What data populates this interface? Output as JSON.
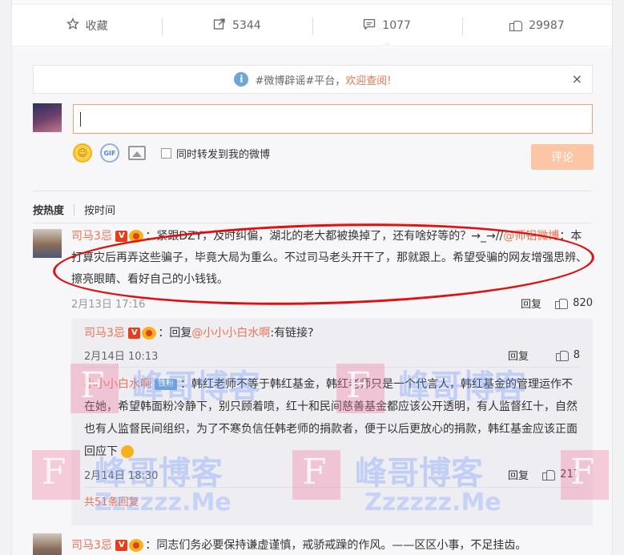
{
  "actions": [
    {
      "icon": "star-icon",
      "label": "收藏"
    },
    {
      "icon": "share-icon",
      "label": "5344"
    },
    {
      "icon": "comment-icon",
      "label": "1077"
    },
    {
      "icon": "thumbs-up-icon",
      "label": "29987"
    }
  ],
  "notice": {
    "text": "#微博辟谣#平台，",
    "link": "欢迎查阅!",
    "close": "×"
  },
  "composer": {
    "forward_label": "同时转发到我的微博",
    "submit": "评论",
    "gif_label": "GIF"
  },
  "sort": {
    "hot": "按热度",
    "time": "按时间"
  },
  "comment1": {
    "user": "司马3忌",
    "text_a": "：紧跟DZY，及时纠偏，湖北的老大都被换掉了，还有啥好等的？→_→//",
    "mention": "@师铝微博",
    "text_b": "：本打算灾后再弄这些骗子，毕竟大局为重么。不过司马老头开干了，那就跟上。希望受骗的网友增强思辨、擦亮眼睛、看好自己的小钱钱。",
    "time": "2月13日 17:16",
    "reply": "回复",
    "likes": "820"
  },
  "replies": [
    {
      "user": "司马3忌",
      "prefix": "：回复",
      "mention": "@小小小白水啊",
      "text": ":有链接?",
      "time": "2月14日 10:13",
      "reply": "回复",
      "likes": "8"
    },
    {
      "user": "小小小白水啊",
      "tag": "铁粉",
      "text": "：韩红老师不等于韩红基金，韩红老师只是一个代言人，韩红基金的管理运作不在她，希望韩面粉冷静下，别只顾着喷，红十和民间慈善基金都应该公开透明，有人监督红十，自然也有人监督民间组织，为了不寒负信任韩老师的捐款者，便于以后更放心的捐款，韩红基金应该正面回应下",
      "time": "2月14日 18:30",
      "reply": "回复",
      "likes": "217"
    }
  ],
  "more_replies": "共51条回复",
  "comment2": {
    "user": "司马3忌",
    "text": "：同志们务必要保持谦虚谨慎，戒骄戒躁的作风。——区区小事，不足挂齿。"
  },
  "watermark": {
    "f": "F",
    "cn": "峰哥博客",
    "url": "Zzzzzz.Me"
  },
  "colors": {
    "accent": "#eb7350",
    "highlight": "#e01010"
  }
}
